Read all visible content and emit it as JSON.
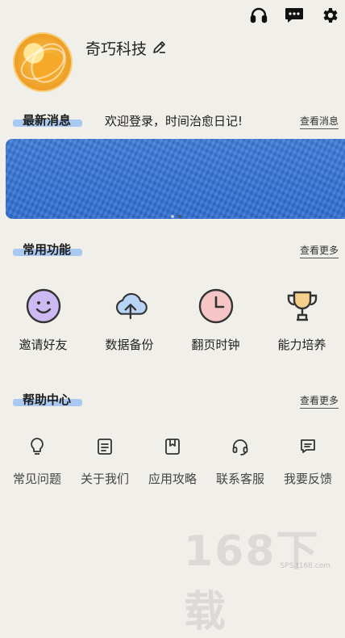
{
  "topbar": {
    "icons": [
      "headset-icon",
      "chat-icon",
      "gear-icon"
    ]
  },
  "profile": {
    "name": "奇巧科技"
  },
  "news": {
    "title": "最新消息",
    "message": "欢迎登录，时间治愈日记!",
    "more": "查看消息"
  },
  "banner": {
    "color": "#3572d6",
    "pages": 2,
    "active_page": 2
  },
  "common": {
    "title": "常用功能",
    "more": "查看更多",
    "items": [
      {
        "label": "邀请好友",
        "icon": "smiley-icon"
      },
      {
        "label": "数据备份",
        "icon": "cloud-upload-icon"
      },
      {
        "label": "翻页时钟",
        "icon": "clock-icon"
      },
      {
        "label": "能力培养",
        "icon": "trophy-icon"
      }
    ]
  },
  "help": {
    "title": "帮助中心",
    "more": "查看更多",
    "items": [
      {
        "label": "常见问题",
        "icon": "lightbulb-icon"
      },
      {
        "label": "关于我们",
        "icon": "document-icon"
      },
      {
        "label": "应用攻略",
        "icon": "bookmark-icon"
      },
      {
        "label": "联系客服",
        "icon": "headset-icon"
      },
      {
        "label": "我要反馈",
        "icon": "message-icon"
      }
    ]
  },
  "watermark": {
    "big": "168下载",
    "small": "SPS.t168.com"
  },
  "colors": {
    "background": "#f1efe9",
    "highlight": "#a9c9f1",
    "accent_purple": "#c9b6f0",
    "accent_pink": "#f7c9c9"
  }
}
